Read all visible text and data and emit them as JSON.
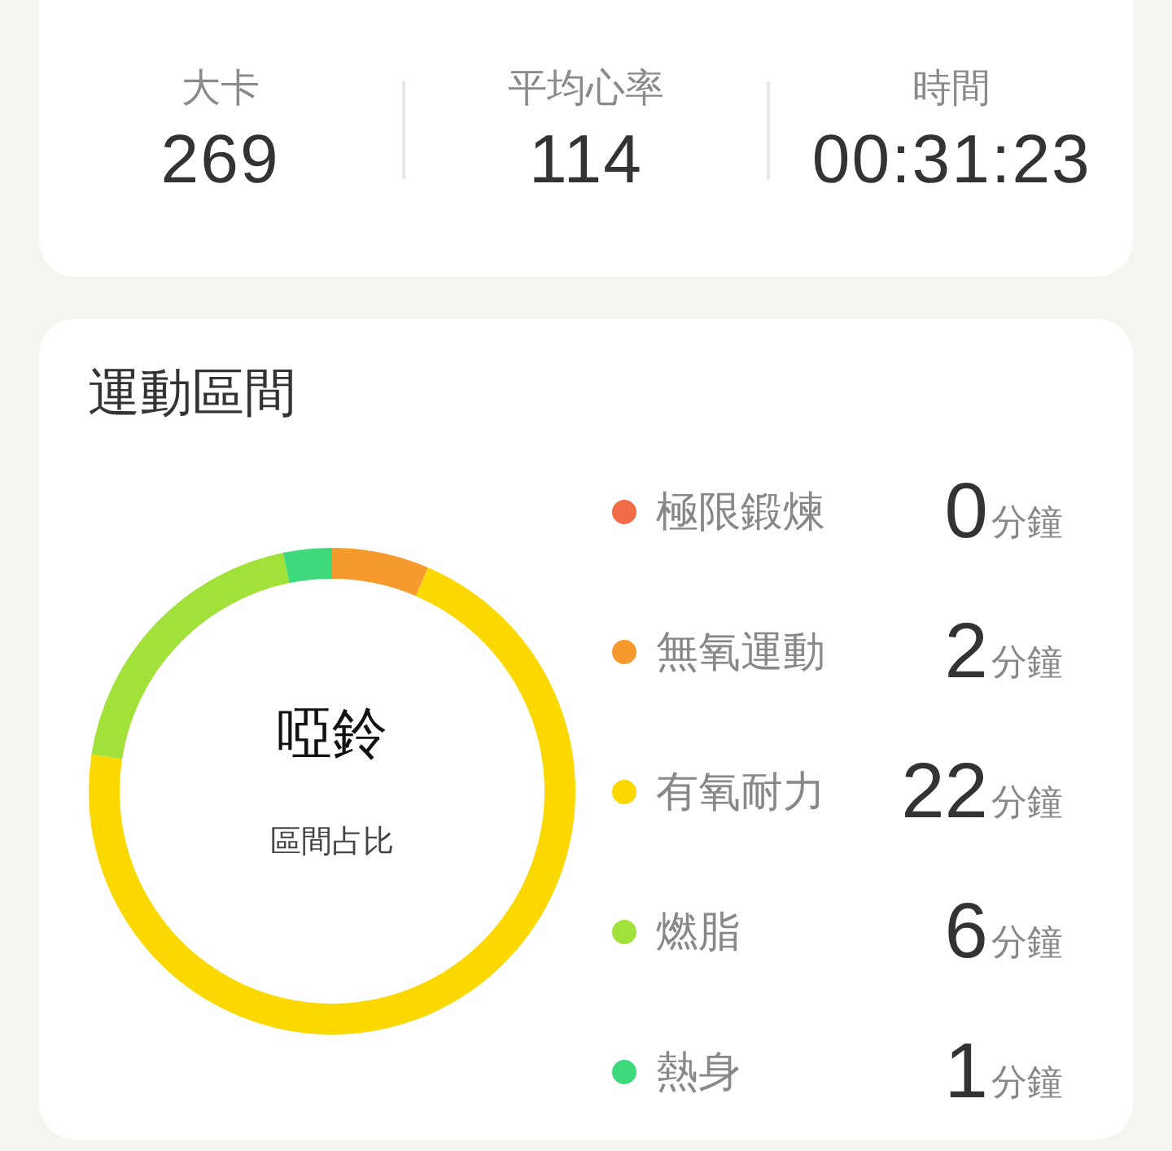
{
  "summary": {
    "stats": [
      {
        "label": "大卡",
        "value": "269"
      },
      {
        "label": "平均心率",
        "value": "114"
      },
      {
        "label": "時間",
        "value": "00:31:23"
      }
    ]
  },
  "zones_card": {
    "title": "運動區間",
    "center_title": "啞鈴",
    "center_subtitle": "區間占比",
    "zones": [
      {
        "name": "極限鍛煉",
        "minutes": "0",
        "unit": "分鐘",
        "color": "#f26b47"
      },
      {
        "name": "無氧運動",
        "minutes": "2",
        "unit": "分鐘",
        "color": "#f79a2e"
      },
      {
        "name": "有氧耐力",
        "minutes": "22",
        "unit": "分鐘",
        "color": "#fbd800"
      },
      {
        "name": "燃脂",
        "minutes": "6",
        "unit": "分鐘",
        "color": "#a2e03a"
      },
      {
        "name": "熱身",
        "minutes": "1",
        "unit": "分鐘",
        "color": "#3ed97a"
      }
    ]
  }
}
